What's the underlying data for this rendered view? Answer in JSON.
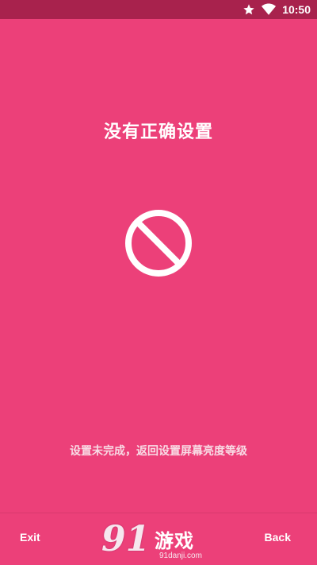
{
  "status_bar": {
    "time": "10:50",
    "icons": [
      "star-icon",
      "wifi-icon"
    ]
  },
  "main": {
    "title": "没有正确设置",
    "icon": "block-icon",
    "message": "设置未完成，返回设置屏幕亮度等级"
  },
  "bottom_bar": {
    "exit_label": "Exit",
    "back_label": "Back"
  },
  "watermark": {
    "logo": "91",
    "text": "游戏",
    "url": "91danji.com"
  },
  "colors": {
    "background": "#ec4079",
    "status_bar": "#a8224d",
    "foreground": "#ffffff"
  }
}
